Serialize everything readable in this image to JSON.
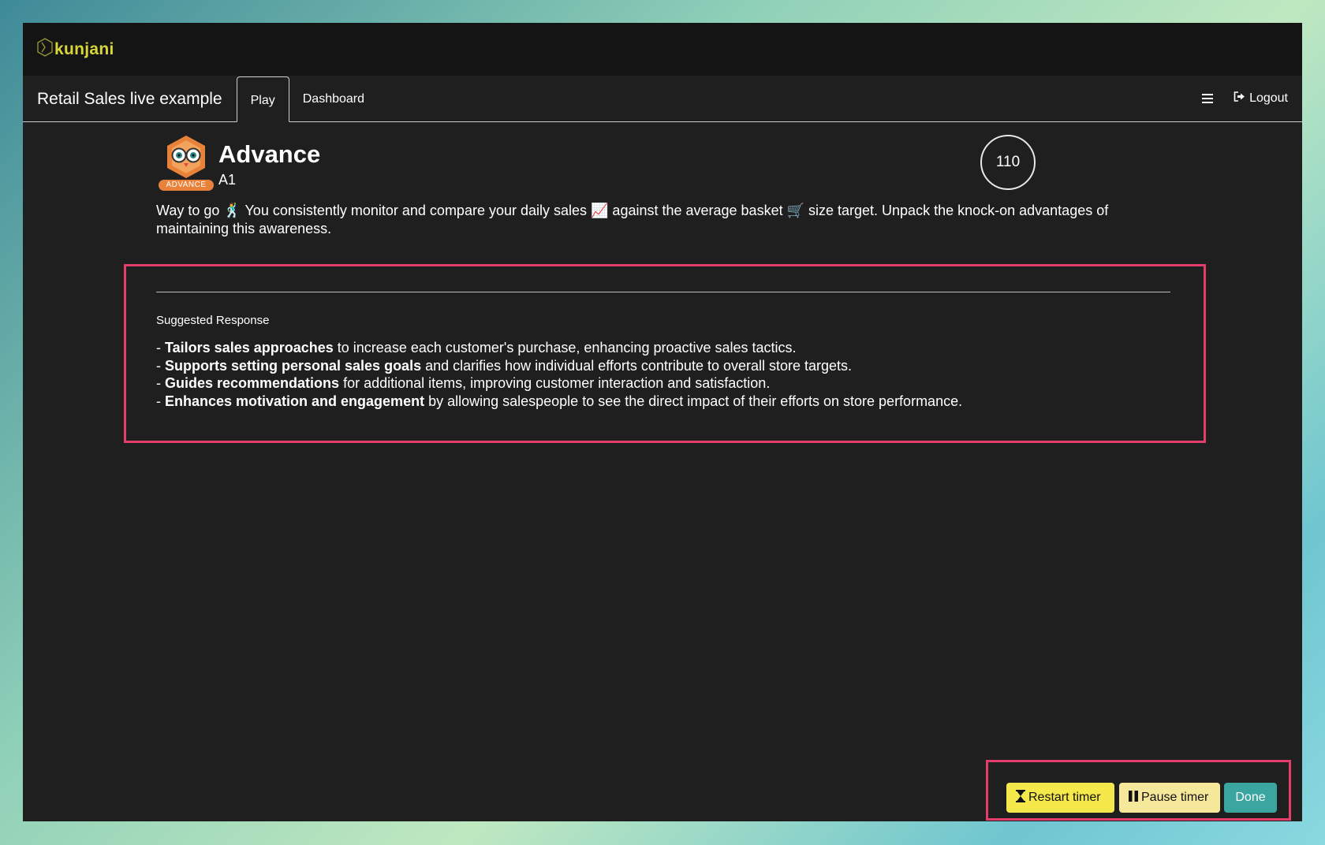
{
  "brand": {
    "logo_text": "kunjani",
    "logo_icon": "kunjani-logo-icon"
  },
  "navbar": {
    "title": "Retail Sales live example",
    "tabs": [
      {
        "label": "Play",
        "active": true
      },
      {
        "label": "Dashboard",
        "active": false
      }
    ],
    "menu_icon": "hamburger-icon",
    "logout_label": "Logout",
    "logout_icon": "sign-out-icon"
  },
  "level": {
    "badge": "ADVANCE",
    "title": "Advance",
    "subtitle": "A1",
    "avatar_icon": "owl-avatar-icon"
  },
  "timer": {
    "value": "110"
  },
  "prompt": {
    "text": "Way to go 🕺 You consistently monitor and compare your daily sales 📈 against the average basket 🛒 size target. Unpack the knock-on advantages of maintaining this awareness."
  },
  "response": {
    "label": "Suggested Response",
    "items": [
      {
        "bold": "Tailors sales approaches",
        "rest": " to increase each customer's purchase, enhancing proactive sales tactics."
      },
      {
        "bold": "Supports setting personal sales goals",
        "rest": " and clarifies how individual efforts contribute to overall store targets."
      },
      {
        "bold": "Guides recommendations",
        "rest": " for additional items, improving customer interaction and satisfaction."
      },
      {
        "bold": "Enhances motivation and engagement",
        "rest": " by allowing salespeople to see the direct impact of their efforts on store performance."
      }
    ]
  },
  "actions": {
    "restart_label": "Restart timer",
    "restart_icon": "hourglass-icon",
    "pause_label": "Pause timer",
    "pause_icon": "pause-icon",
    "done_label": "Done"
  },
  "colors": {
    "accent_yellow": "#f5e84a",
    "done_teal": "#3aa69f",
    "highlight_border": "#e23d6b",
    "badge_orange": "#e8823a",
    "logo_yellow": "#d8d63a"
  }
}
